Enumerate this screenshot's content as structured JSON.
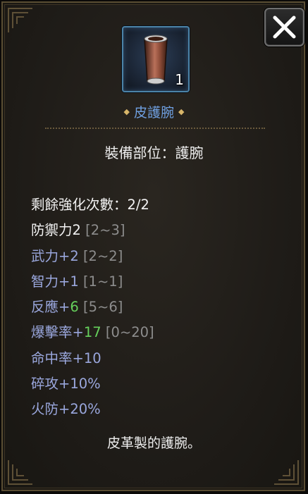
{
  "item": {
    "name": "皮護腕",
    "count": "1",
    "icon": "leather-bracer-icon"
  },
  "equip_slot": "裝備部位：護腕",
  "enhance": "剩餘強化次數：2/2",
  "stats": [
    {
      "label": "防禦力2",
      "bonus": "",
      "range": "[2~3]",
      "style": "white"
    },
    {
      "label": "武力+2",
      "bonus": "",
      "range": "[2~2]",
      "style": "blue"
    },
    {
      "label": "智力+1",
      "bonus": "",
      "range": "[1~1]",
      "style": "blue"
    },
    {
      "label": "反應+",
      "bonus": "6",
      "range": "[5~6]",
      "style": "blue"
    },
    {
      "label": "爆擊率+",
      "bonus": "17",
      "range": "[0~20]",
      "style": "blue"
    },
    {
      "label": "命中率+10",
      "bonus": "",
      "range": "",
      "style": "blue"
    },
    {
      "label": "碎攻+10%",
      "bonus": "",
      "range": "",
      "style": "blue"
    },
    {
      "label": "火防+20%",
      "bonus": "",
      "range": "",
      "style": "blue"
    }
  ],
  "description": "皮革製的護腕。",
  "colors": {
    "title": "#6f9fe0",
    "stat_blue": "#9aa7dd",
    "bonus_green": "#66d15c",
    "range_gray": "#8d8d8d",
    "frame_gold": "#5a4d33"
  }
}
